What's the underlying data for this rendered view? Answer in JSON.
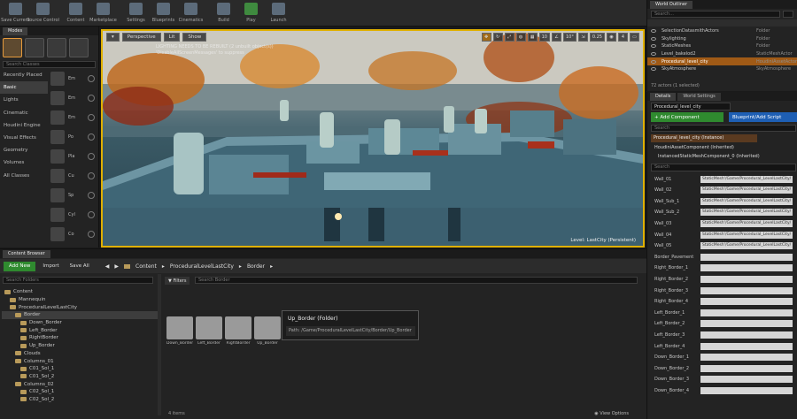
{
  "toolbar": {
    "buttons": [
      {
        "label": "Save Current",
        "icon": "save-icon"
      },
      {
        "label": "Source Control",
        "icon": "source-control-icon"
      },
      {
        "label": "Content",
        "icon": "content-icon"
      },
      {
        "label": "Marketplace",
        "icon": "marketplace-icon"
      },
      {
        "label": "Settings",
        "icon": "gear-icon"
      },
      {
        "label": "Blueprints",
        "icon": "blueprint-icon"
      },
      {
        "label": "Cinematics",
        "icon": "clapper-icon"
      },
      {
        "label": "Build",
        "icon": "build-icon"
      },
      {
        "label": "Play",
        "icon": "play-icon"
      },
      {
        "label": "Launch",
        "icon": "launch-icon"
      }
    ]
  },
  "modes": {
    "tab": "Modes",
    "search_placeholder": "Search Classes",
    "categories": [
      "Recently Placed",
      "Basic",
      "Lights",
      "Cinematic",
      "Houdini Engine",
      "Visual Effects",
      "Geometry",
      "Volumes",
      "All Classes"
    ],
    "active_category": "Basic",
    "items": [
      "Em",
      "Em",
      "Em",
      "Po",
      "Pla",
      "Cu",
      "Sp",
      "Cyl",
      "Co"
    ]
  },
  "viewport": {
    "buttons": [
      "Perspective",
      "Lit",
      "Show"
    ],
    "message_1": "LIGHTING NEEDS TO BE REBUILT (2 unbuilt object(s))",
    "message_2": "'DisableAllScreenMessages' to suppress",
    "right_controls": [
      "10",
      "10°",
      "0.25",
      "4"
    ],
    "level_label": "Level: LastCity (Persistent)"
  },
  "outliner": {
    "tab": "World Outliner",
    "search_placeholder": "Search...",
    "rows": [
      {
        "name": "SelectionDatasmithActors",
        "type": "Folder"
      },
      {
        "name": "Skylighting",
        "type": "Folder"
      },
      {
        "name": "StaticMeshes",
        "type": "Folder"
      },
      {
        "name": "Level_bakelod2",
        "type": "StaticMeshActor"
      },
      {
        "name": "Procedural_level_city",
        "type": "HoudiniAssetActor"
      },
      {
        "name": "SkyAtmosphere",
        "type": "SkyAtmosphere"
      }
    ],
    "status": "72 actors (1 selected)"
  },
  "details": {
    "tabs": [
      "Details",
      "World Settings"
    ],
    "actor_name": "Procedural_level_city",
    "add_component": "+ Add Component",
    "blueprint_button": "Blueprint/Add Script",
    "search_placeholder": "Search",
    "components": [
      "Procedural_level_city (Instance)",
      "HoudiniAssetComponent (Inherited)",
      "InstancedStaticMeshComponent_0 (Inherited)"
    ],
    "properties": [
      {
        "name": "Wall_01",
        "value": "StaticMesh'/Game/Procedural_LevelLastCity/"
      },
      {
        "name": "Wall_02",
        "value": "StaticMesh'/Game/Procedural_LevelLastCity/"
      },
      {
        "name": "Wall_Sub_1",
        "value": "StaticMesh'/Game/Procedural_LevelLastCity/"
      },
      {
        "name": "Wall_Sub_2",
        "value": "StaticMesh'/Game/Procedural_LevelLastCity/"
      },
      {
        "name": "Wall_03",
        "value": "StaticMesh'/Game/Procedural_LevelLastCity/"
      },
      {
        "name": "Wall_04",
        "value": "StaticMesh'/Game/Procedural_LevelLastCity/"
      },
      {
        "name": "Wall_05",
        "value": "StaticMesh'/Game/Procedural_LevelLastCity/"
      },
      {
        "name": "Border_Pavement",
        "value": ""
      },
      {
        "name": "Right_Border_1",
        "value": ""
      },
      {
        "name": "Right_Border_2",
        "value": ""
      },
      {
        "name": "Right_Border_3",
        "value": ""
      },
      {
        "name": "Right_Border_4",
        "value": ""
      },
      {
        "name": "Left_Border_1",
        "value": ""
      },
      {
        "name": "Left_Border_2",
        "value": ""
      },
      {
        "name": "Left_Border_3",
        "value": ""
      },
      {
        "name": "Left_Border_4",
        "value": ""
      },
      {
        "name": "Down_Border_1",
        "value": ""
      },
      {
        "name": "Down_Border_2",
        "value": ""
      },
      {
        "name": "Down_Border_3",
        "value": ""
      },
      {
        "name": "Down_Border_4",
        "value": ""
      }
    ]
  },
  "content_browser": {
    "tab": "Content Browser",
    "add_new": "Add New",
    "import": "Import",
    "save_all": "Save All",
    "breadcrumb": [
      "Content",
      "ProceduralLevelLastCity",
      "Border"
    ],
    "filters": "Filters",
    "search_folders_placeholder": "Search Folders",
    "search_assets_placeholder": "Search Border",
    "tree": [
      {
        "label": "Content",
        "indent": 0
      },
      {
        "label": "Mannequin",
        "indent": 1
      },
      {
        "label": "ProceduralLevelLastCity",
        "indent": 1
      },
      {
        "label": "Border",
        "indent": 2
      },
      {
        "label": "Down_Border",
        "indent": 3
      },
      {
        "label": "Left_Border",
        "indent": 3
      },
      {
        "label": "RightBorder",
        "indent": 3
      },
      {
        "label": "Up_Border",
        "indent": 3
      },
      {
        "label": "Clouds",
        "indent": 2
      },
      {
        "label": "Columns_01",
        "indent": 2
      },
      {
        "label": "C01_Sol_1",
        "indent": 3
      },
      {
        "label": "C01_Sol_2",
        "indent": 3
      },
      {
        "label": "Columns_02",
        "indent": 2
      },
      {
        "label": "C02_Sol_1",
        "indent": 3
      },
      {
        "label": "C02_Sol_2",
        "indent": 3
      }
    ],
    "assets": [
      "Down_Border",
      "Left_Border",
      "RightBorder",
      "Up_Border"
    ],
    "tooltip_title": "Up_Border (Folder)",
    "tooltip_path": "Path: /Game/ProceduralLevelLastCity/Border/Up_Border",
    "item_count": "4 items",
    "view_options": "View Options"
  },
  "colors": {
    "accent_green": "#2f8a2f",
    "accent_blue": "#1e5fb4",
    "selection_orange": "#a05a16",
    "viewport_border": "#e0b000"
  }
}
